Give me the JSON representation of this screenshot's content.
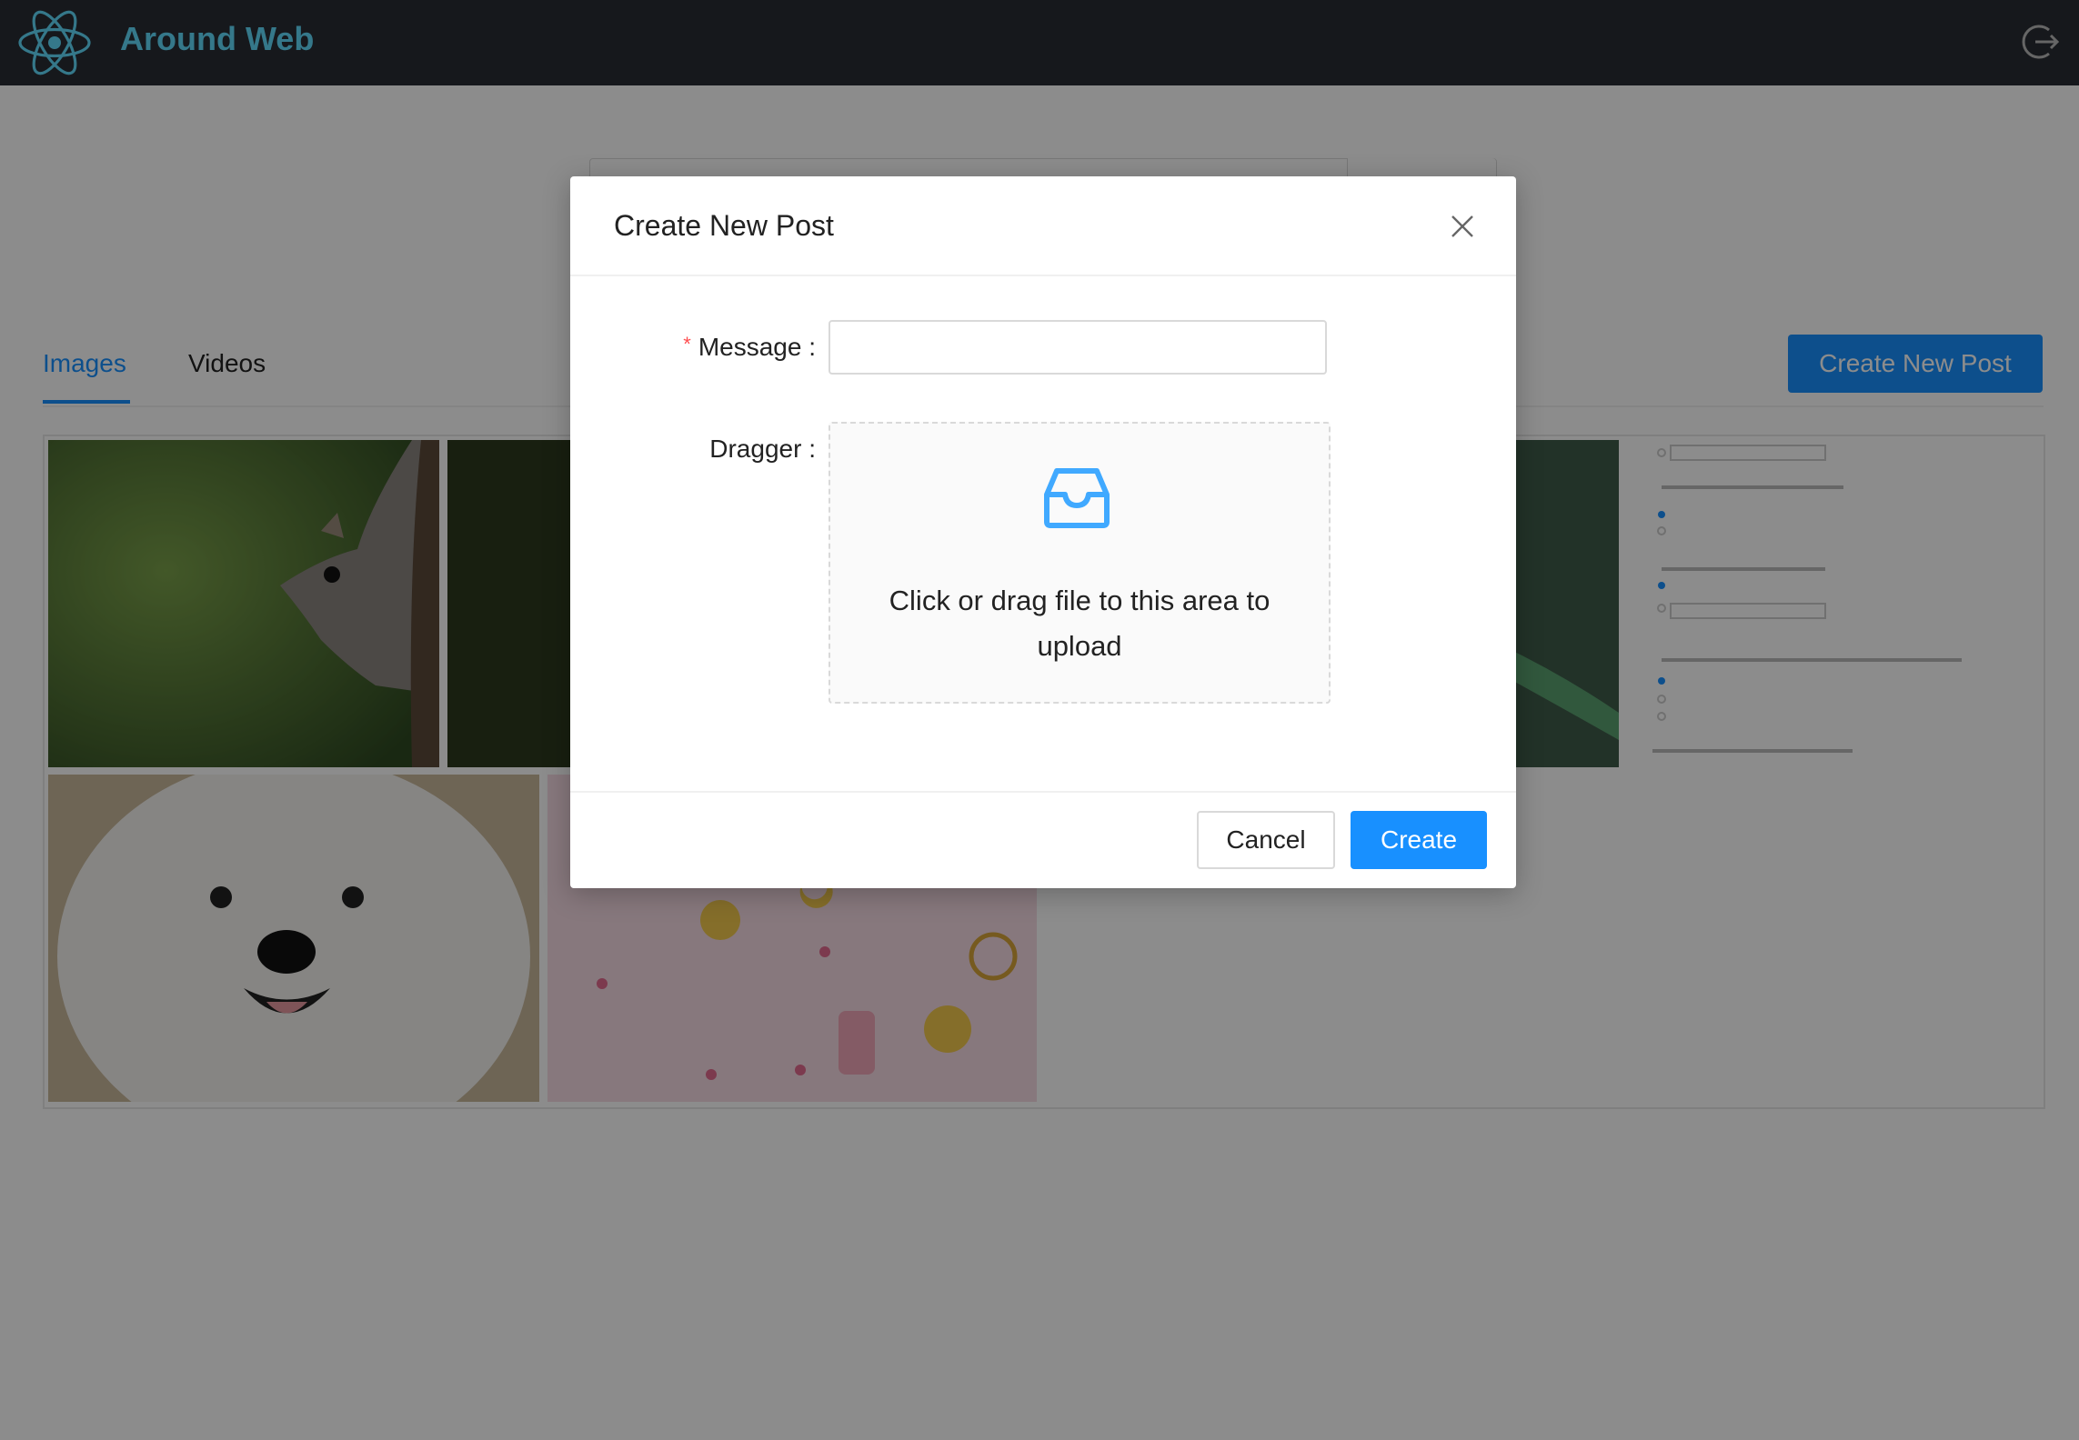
{
  "app": {
    "title": "Around Web"
  },
  "tabs": [
    {
      "label": "Images",
      "active": true
    },
    {
      "label": "Videos",
      "active": false
    }
  ],
  "toolbar": {
    "create_post_label": "Create New Post"
  },
  "gallery": {
    "images": [
      {
        "subject": "squirrel"
      },
      {
        "subject": "dark foliage"
      },
      {
        "subject": "hummingbird"
      },
      {
        "subject": "form screenshot"
      },
      {
        "subject": "white dog"
      },
      {
        "subject": "sailor moon pattern"
      }
    ]
  },
  "modal": {
    "title": "Create New Post",
    "message_label": "Message",
    "message_required_mark": "*",
    "message_value": "",
    "dragger_label": "Dragger",
    "dragger_text": "Click or drag file to this area to upload",
    "cancel_label": "Cancel",
    "create_label": "Create"
  },
  "icons": {
    "logo": "react-atom-icon",
    "logout": "logout-icon",
    "close": "close-icon",
    "upload": "inbox-icon"
  },
  "colors": {
    "header_bg": "#282c34",
    "brand": "#61dafb",
    "primary": "#1890ff",
    "required": "#ff4d4f"
  }
}
